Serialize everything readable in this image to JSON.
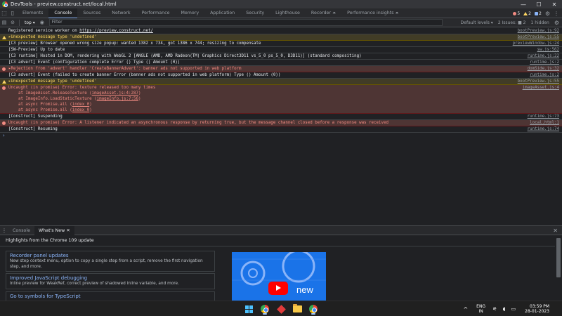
{
  "window": {
    "title": "DevTools - preview.construct.net/local.html",
    "controls": {
      "minimize": "—",
      "maximize": "☐",
      "close": "✕"
    }
  },
  "devtools_tabs": [
    "Elements",
    "Console",
    "Sources",
    "Network",
    "Performance",
    "Memory",
    "Application",
    "Security",
    "Lighthouse",
    "Recorder ⏶",
    "Performance insights ⏶"
  ],
  "active_tab": "Console",
  "status": {
    "errors": "5",
    "warnings": "2",
    "info": "2"
  },
  "console_toolbar": {
    "context": "top ▾",
    "filter_placeholder": "Filter",
    "levels": "Default levels ▾",
    "issues": "2 Issues: ■ 2",
    "hidden": "1 hidden"
  },
  "messages": [
    {
      "type": "info",
      "parts": [
        "Registered service worker on ",
        {
          "link": "https://preview.construct.net/"
        }
      ],
      "source": "bootPreview.js:92"
    },
    {
      "type": "warn",
      "parts": [
        "▸Unexpected message type 'undefined'"
      ],
      "source": "bootPreview.js:55"
    },
    {
      "type": "info",
      "parts": [
        "[C3 preview] Browser opened wrong size popup: wanted 1382 x 734, got 1386 x 744; resizing to compensate"
      ],
      "source": "previewWindow.js:24"
    },
    {
      "type": "info",
      "parts": [
        "[SW-Preview] Up to date"
      ],
      "source": "sw.js:562"
    },
    {
      "type": "info",
      "parts": [
        "[C3 runtime] Hosted in DOM, rendering with WebGL 2 [ANGLE (AMD, AMD Radeon(TM) Graphics Direct3D11 vs_5_0 ps_5_0, D3D11)] (standard compositing)"
      ],
      "source": "runtime.js:22"
    },
    {
      "type": "info",
      "parts": [
        "[C3 advert] Event (configuration complete Error () Type () Amount (0))"
      ],
      "source": "runtime.js:2"
    },
    {
      "type": "error",
      "parts": [
        "▸Rejection from 'advert' handler 'CreateBannerAdvert': banner ads not supported in web platform"
      ],
      "source": "domSide.js:32"
    },
    {
      "type": "info",
      "parts": [
        "[C3 advert] Event (failed to create banner Error (banner ads not supported in web platform) Type () Amount (0))"
      ],
      "source": "runtime.js:2"
    },
    {
      "type": "warn",
      "parts": [
        "▸Unexpected message type 'undefined'"
      ],
      "source": "bootPreview.js:55"
    },
    {
      "type": "error",
      "parts": [
        "Uncaught (in promise) Error: texture released too many times\n    at ImageAsset.ReleaseTexture (",
        {
          "link": "imageAsset.js:4:287"
        },
        ")\n    at ImageInfo.LoadStaticTexture (",
        {
          "link": "imageInfo.js:7:56"
        },
        ")\n    at async Promise.all (",
        {
          "link": "index 0"
        },
        ")\n    at async Promise.all (",
        {
          "link": "index 0"
        },
        ")"
      ],
      "source": "imageAsset.js:4"
    },
    {
      "type": "info",
      "parts": [
        "[Construct] Suspending"
      ],
      "source": "runtime.js:73"
    },
    {
      "type": "error",
      "parts": [
        "Uncaught (in promise) Error: A listener indicated an asynchronous response by returning true, but the message channel closed before a response was received"
      ],
      "source": "local.html:1"
    },
    {
      "type": "info",
      "parts": [
        "[Construct] Resuming"
      ],
      "source": "runtime.js:74"
    }
  ],
  "prompt": "›",
  "drawer": {
    "tabs": [
      "Console",
      "What's New"
    ],
    "active": "What's New",
    "close": "✕",
    "highlight": "Highlights from the Chrome 109 update",
    "cards": [
      {
        "title": "Recorder panel updates",
        "desc": "New step context menu, option to copy a single step from a script, remove the first navigation step, and more."
      },
      {
        "title": "Improved JavaScript debugging",
        "desc": "Inline preview for WeakRef, correct preview of shadowed inline variable, and more."
      },
      {
        "title": "Go to symbols for TypeScript",
        "desc": ""
      }
    ],
    "promo_text": "new"
  },
  "taskbar": {
    "lang_1": "ENG",
    "lang_2": "IN",
    "time": "03:59 PM",
    "date": "28-01-2023",
    "chevron": "^",
    "sys_icons": "⚟ ◖ ▭"
  },
  "colors": {
    "accent": "#8ab4f8",
    "error": "#f28b82",
    "warning": "#fdd663",
    "background": "#202124"
  }
}
